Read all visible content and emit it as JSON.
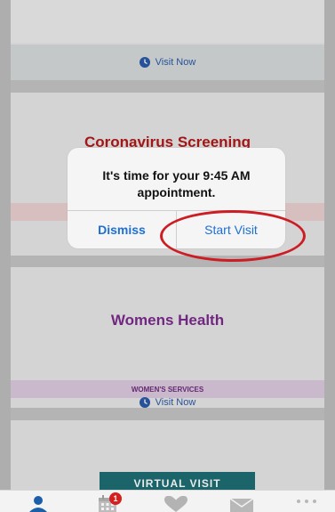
{
  "cards": [
    {
      "visit_label": "Visit Now"
    },
    {
      "title": "Coronavirus Screening"
    },
    {
      "title": "Womens Health",
      "category": "WOMEN'S SERVICES",
      "visit_label": "Visit Now"
    },
    {
      "button_label": "VIRTUAL VISIT"
    }
  ],
  "alert": {
    "message": "It's time for your 9:45 AM appointment.",
    "dismiss_label": "Dismiss",
    "start_label": "Start Visit"
  },
  "tabbar": {
    "calendar_badge": "1",
    "icons": [
      "person-icon",
      "calendar-icon",
      "heart-icon",
      "mail-icon",
      "more-icon"
    ]
  },
  "colors": {
    "link_blue": "#2b5aa6",
    "ios_blue": "#1d6fd6",
    "screening_red": "#b01818",
    "womens_purple": "#7b2b8e",
    "virtual_teal": "#1e6e73",
    "highlight_red": "#cc1d24"
  }
}
